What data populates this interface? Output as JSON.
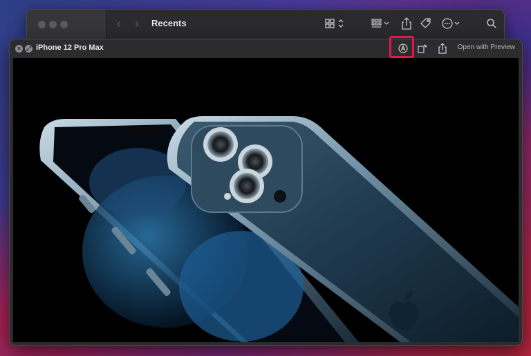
{
  "finder": {
    "title": "Recents",
    "icons": [
      "back-chevron-icon",
      "forward-chevron-icon",
      "grid-view-icon",
      "group-by-icon",
      "share-icon",
      "tag-icon",
      "more-icon",
      "search-icon"
    ]
  },
  "quicklook": {
    "title": "iPhone 12 Pro Max",
    "open_label": "Open with Preview",
    "icons": [
      "close-icon",
      "fullscreen-icon",
      "markup-icon",
      "rotate-icon",
      "share-icon"
    ],
    "highlight_color": "#e0174f"
  },
  "image": {
    "subject": "iphone-12-pro-max-photo"
  }
}
